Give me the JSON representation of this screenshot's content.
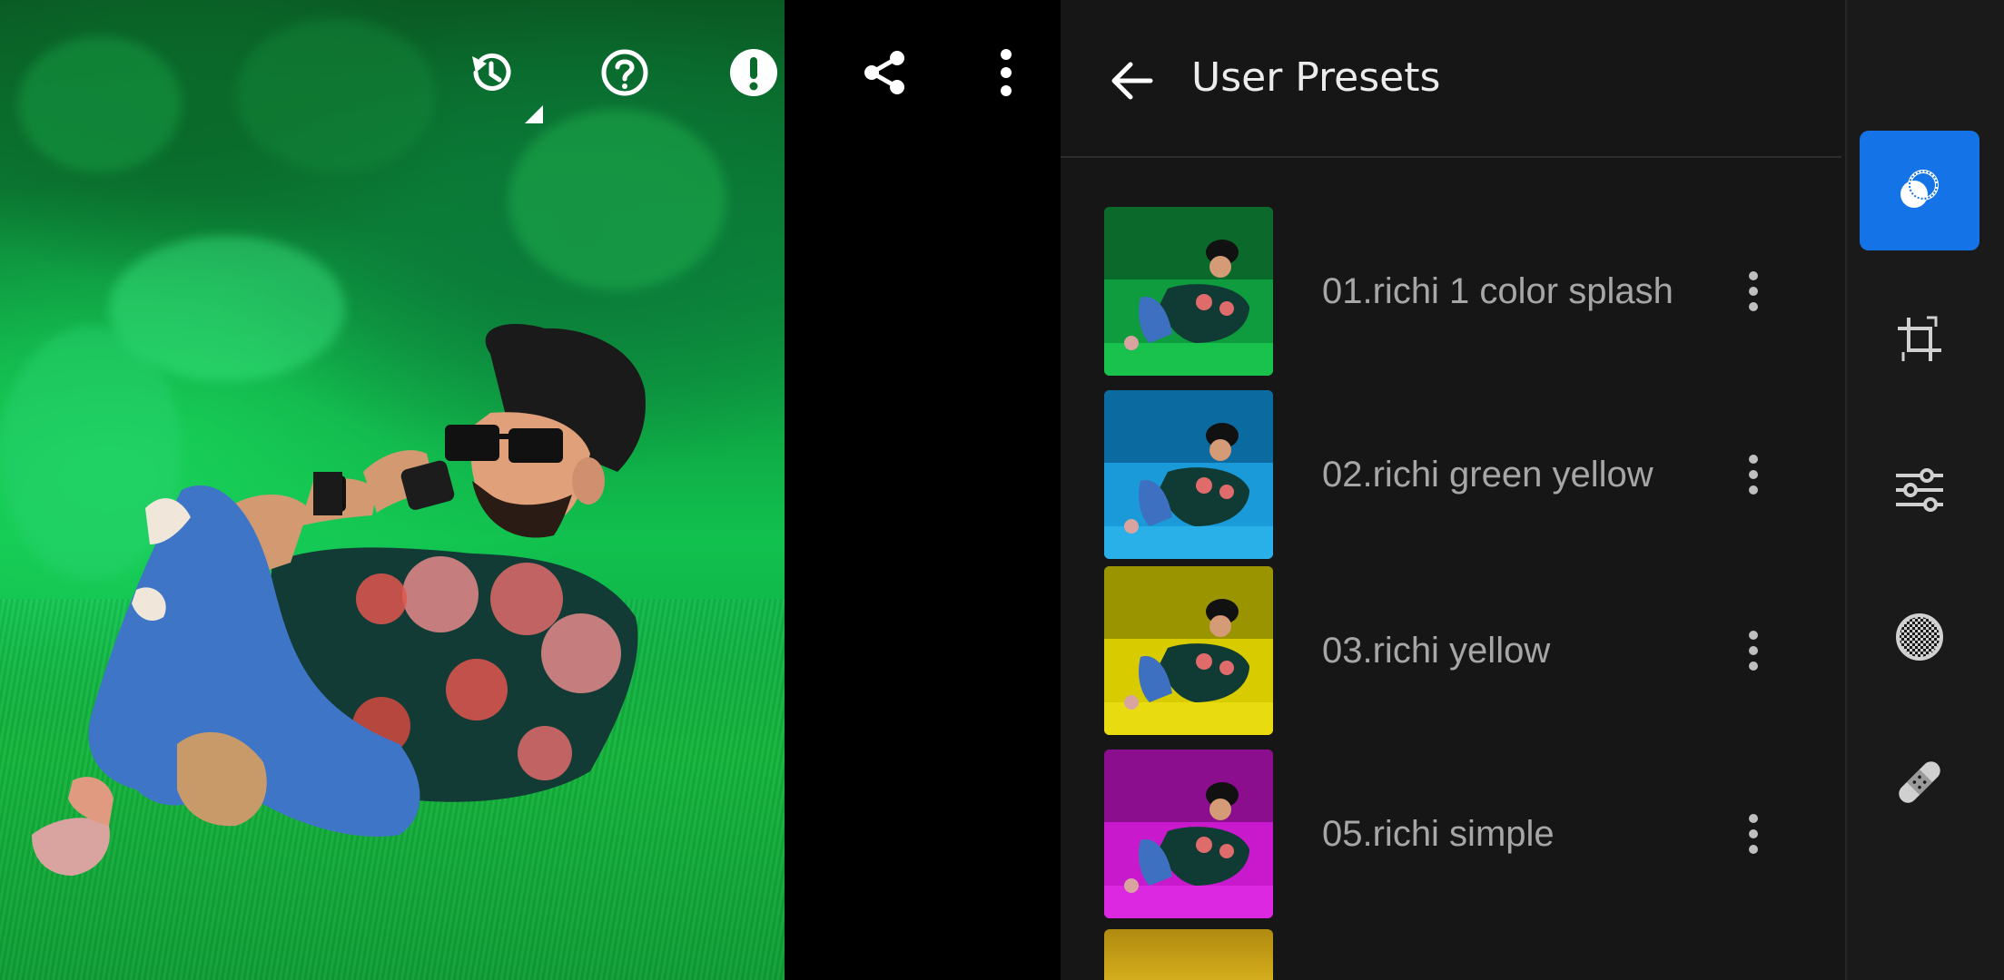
{
  "toolbar": {
    "icons": [
      "history-icon",
      "help-icon",
      "alert-icon",
      "share-icon",
      "more-vertical-icon"
    ]
  },
  "panel": {
    "title": "User Presets",
    "back_icon": "arrow-left-icon",
    "presets": [
      {
        "name": "01.richi 1 color splash",
        "tint": "#12c85a"
      },
      {
        "name": "02.richi green yellow",
        "tint": "#22a6e0"
      },
      {
        "name": "03.richi yellow",
        "tint": "#e0d400"
      },
      {
        "name": "05.richi simple",
        "tint": "#d41ad8"
      }
    ],
    "partial_preset_tint": "#c8a21a"
  },
  "rail": {
    "tools": [
      "presets-icon",
      "crop-icon",
      "adjust-sliders-icon",
      "selective-masking-icon",
      "healing-bandage-icon"
    ],
    "active": "presets-icon",
    "accent": "#1473e6"
  }
}
